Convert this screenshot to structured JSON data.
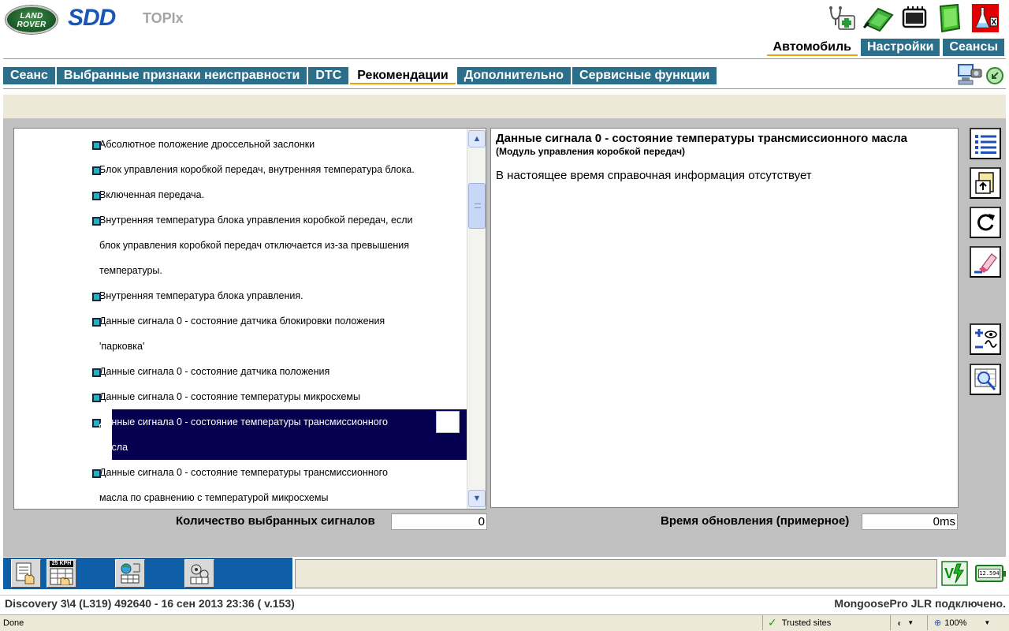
{
  "brand": {
    "logo_line1": "LAND",
    "logo_line2": "ROVER",
    "app": "SDD",
    "module": "TOPIx"
  },
  "toolbar_icons": [
    "stethoscope-medkit-icon",
    "green-cable-icon",
    "module-chip-icon",
    "green-book-icon",
    "red-flask-icon"
  ],
  "main_tabs": [
    {
      "label": "Автомобиль",
      "active": true
    },
    {
      "label": "Настройки",
      "active": false
    },
    {
      "label": "Сеансы",
      "active": false
    }
  ],
  "sub_tabs": [
    {
      "label": "Сеанс",
      "active": false
    },
    {
      "label": "Выбранные признаки неисправности",
      "active": false
    },
    {
      "label": "DTC",
      "active": false
    },
    {
      "label": "Рекомендации",
      "active": true
    },
    {
      "label": "Дополнительно",
      "active": false
    },
    {
      "label": "Сервисные функции",
      "active": false
    }
  ],
  "signal_list": [
    {
      "lines": [
        "Абсолютное положение дроссельной заслонки"
      ],
      "selected": false
    },
    {
      "lines": [
        "Блок управления коробкой передач, внутренняя температура блока."
      ],
      "selected": false
    },
    {
      "lines": [
        "Включенная передача."
      ],
      "selected": false
    },
    {
      "lines": [
        "Внутренняя температура блока управления коробкой передач, если",
        "блок управления коробкой передач отключается из-за превышения",
        "температуры."
      ],
      "selected": false
    },
    {
      "lines": [
        "Внутренняя температура блока управления."
      ],
      "selected": false
    },
    {
      "lines": [
        "Данные сигнала 0 - состояние датчика блокировки положения",
        "'парковка'"
      ],
      "selected": false
    },
    {
      "lines": [
        "Данные сигнала 0 - состояние датчика положения"
      ],
      "selected": false
    },
    {
      "lines": [
        "Данные сигнала 0 - состояние температуры микросхемы"
      ],
      "selected": false
    },
    {
      "lines": [
        "Данные сигнала 0 - состояние температуры трансмиссионного",
        "масла"
      ],
      "selected": true
    },
    {
      "lines": [
        "Данные сигнала 0 - состояние температуры трансмиссионного",
        "масла по сравнению с температурой микросхемы"
      ],
      "selected": false
    }
  ],
  "scrollbar": {
    "position": 0.12
  },
  "info": {
    "title": "Данные сигнала 0 - состояние температуры трансмиссионного масла",
    "subtitle": "(Модуль управления коробкой передач)",
    "text": "В настоящее время справочная информация отсутствует"
  },
  "side_tools": [
    "list-view-icon",
    "export-icon",
    "refresh-icon",
    "eraser-icon",
    "add-watch-icon",
    "zoom-graph-icon"
  ],
  "counters": {
    "selected_label": "Количество выбранных сигналов",
    "selected_value": "0",
    "refresh_label": "Время обновления (примерное)",
    "refresh_value": "0ms"
  },
  "taskbar": {
    "speed_badge": "25 KPH",
    "battery_text": "12.594"
  },
  "vehicle_info": "Discovery 3\\4 (L319) 492640 - 16 сен 2013 23:36 ( v.153)",
  "connection_status": "MongoosePro JLR подключено.",
  "browser_status": {
    "done": "Done",
    "zone": "Trusted sites",
    "zoom": "100%"
  },
  "colors": {
    "tab_blue": "#2c6f8a",
    "active_underline": "#e8a400",
    "selected_row": "#04004f",
    "bullet": "#1ab6c4",
    "taskbar_blue": "#0f5ea8"
  }
}
